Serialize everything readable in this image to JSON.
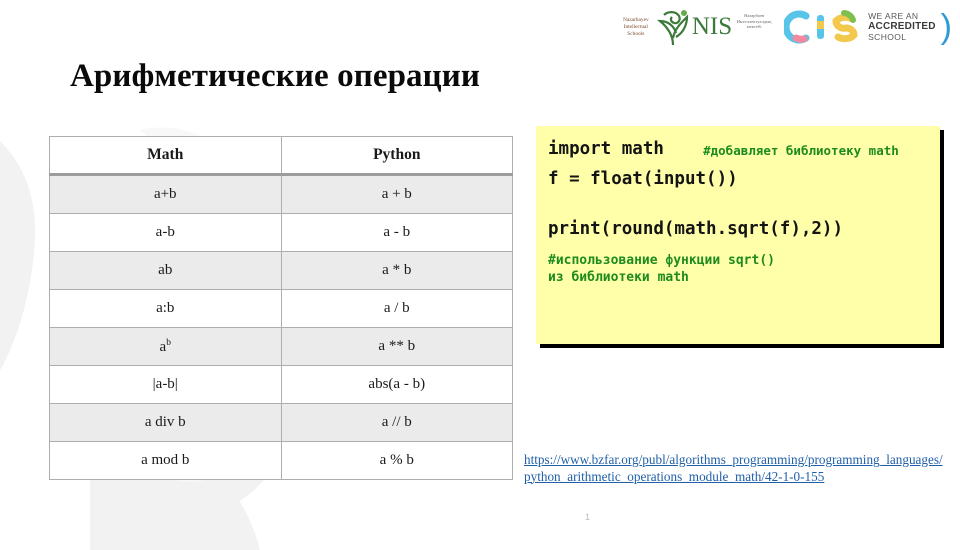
{
  "header": {
    "nis_logo": {
      "words_line1": "Nazarbayev",
      "words_line2": "Intellectual",
      "words_line3": "Schools",
      "abbr": "NIS",
      "ru_line1": "Назарбаев",
      "ru_line2": "Интеллектуалдық",
      "ru_line3": "мектебі"
    },
    "cis_logo": {
      "abbr": "CIS",
      "line1": "WE ARE AN",
      "line2": "ACCREDITED",
      "line3": "SCHOOL",
      "paren": ")"
    }
  },
  "title": "Арифметические операции",
  "table": {
    "columns": [
      "Math",
      "Python"
    ],
    "rows": [
      {
        "math": "a+b",
        "python": "a + b"
      },
      {
        "math": "a-b",
        "python": "a - b"
      },
      {
        "math": "ab",
        "python": "a * b"
      },
      {
        "math": "a:b",
        "python": "a / b"
      },
      {
        "math": "a",
        "math_sup": "b",
        "python": "a ** b"
      },
      {
        "math": "|a-b|",
        "python": "abs(a - b)"
      },
      {
        "math": "a div b",
        "python": "a // b"
      },
      {
        "math": "a mod b",
        "python": "a % b"
      }
    ]
  },
  "code": {
    "line1": "import math",
    "comment1": "#добавляет библиотеку math",
    "line2": "f = float(input())",
    "line3": "print(round(math.sqrt(f),2))",
    "comment2": "#использование функции sqrt()\nиз библиотеки math",
    "background_color": "#ffffaa",
    "comment_color": "#1e8b1e",
    "text_color": "#141414"
  },
  "source_url": "https://www.bzfar.org/publ/algorithms_programming/programming_languages/python_arithmetic_operations_module_math/42-1-0-155",
  "page_number": "1",
  "colors": {
    "link": "#1f5fa8",
    "table_border": "#aeaeae",
    "table_shade": "#ebebeb",
    "nis_green": "#3c7a3c",
    "cis_blue": "#2e9bd6"
  }
}
